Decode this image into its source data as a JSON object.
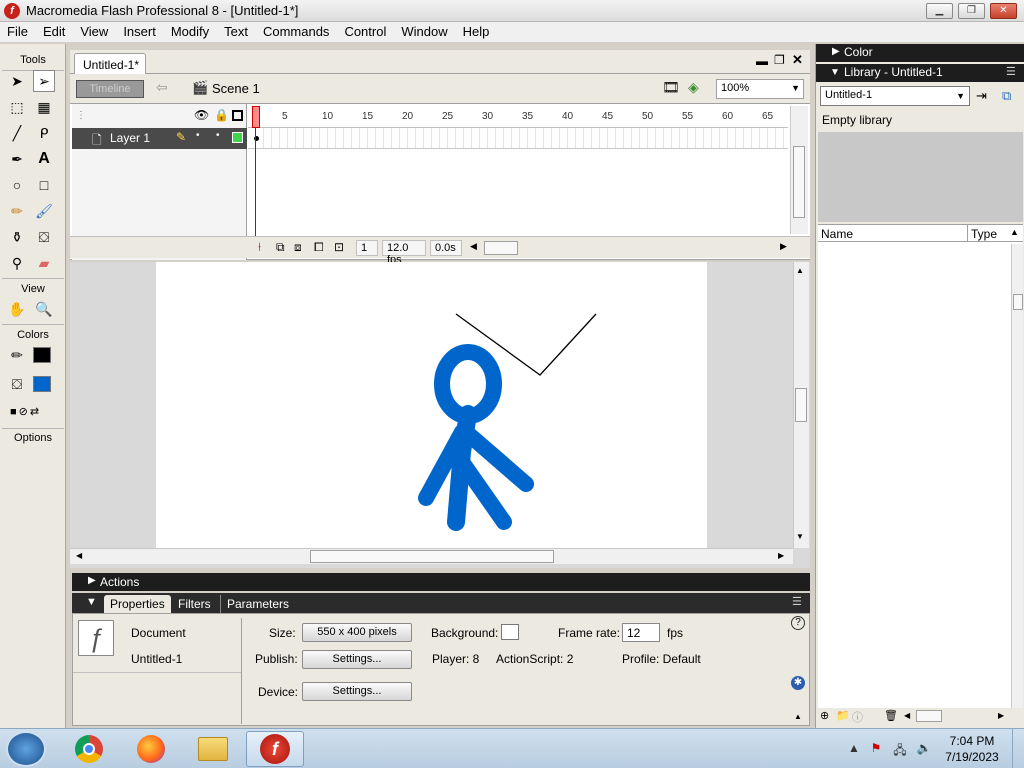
{
  "window": {
    "title": "Macromedia Flash Professional 8 - [Untitled-1*]"
  },
  "menu": [
    "File",
    "Edit",
    "View",
    "Insert",
    "Modify",
    "Text",
    "Commands",
    "Control",
    "Window",
    "Help"
  ],
  "tools": {
    "heading": "Tools",
    "view_heading": "View",
    "colors_heading": "Colors",
    "options_heading": "Options",
    "stroke_color": "#000000",
    "fill_color": "#0066cc"
  },
  "document": {
    "tab_label": "Untitled-1*",
    "timeline_button": "Timeline",
    "scene_label": "Scene 1",
    "zoom": "100%"
  },
  "timeline": {
    "layer_name": "Layer 1",
    "ruler": [
      "5",
      "10",
      "15",
      "20",
      "25",
      "30",
      "35",
      "40",
      "45",
      "50",
      "55",
      "60",
      "65"
    ],
    "current_frame": "1",
    "fps": "12.0 fps",
    "elapsed": "0.0s"
  },
  "panels": {
    "actions_label": "Actions",
    "tabs": [
      "Properties",
      "Filters",
      "Parameters"
    ],
    "doc_type": "Document",
    "doc_name": "Untitled-1",
    "size_label": "Size:",
    "size_value": "550 x 400 pixels",
    "publish_label": "Publish:",
    "settings_label": "Settings...",
    "device_label": "Device:",
    "background_label": "Background:",
    "background_color": "#ffffff",
    "framerate_label": "Frame rate:",
    "framerate_value": "12",
    "fps_unit": "fps",
    "player_text": "Player: 8",
    "actionscript_text": "ActionScript: 2",
    "profile_text": "Profile: Default"
  },
  "right": {
    "color_panel": "Color",
    "library_panel": "Library - Untitled-1",
    "library_select": "Untitled-1",
    "empty_library": "Empty library",
    "col_name": "Name",
    "col_type": "Type"
  },
  "taskbar": {
    "time": "7:04 PM",
    "date": "7/19/2023"
  }
}
